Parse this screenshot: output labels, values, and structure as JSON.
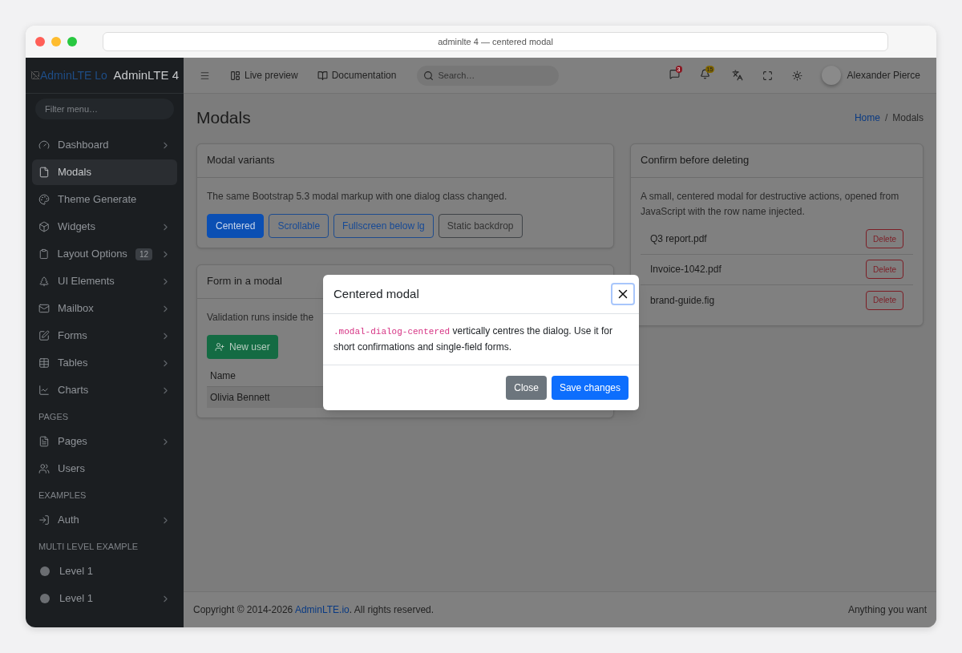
{
  "window": {
    "title": "adminlte 4 — centered modal"
  },
  "brand": {
    "logo_alt": "AdminLTE Lo",
    "name": "AdminLTE 4"
  },
  "sidebar": {
    "filter_placeholder": "Filter menu…",
    "groups": [
      {
        "items": [
          {
            "label": "Dashboard",
            "selected": false,
            "has_children": true
          },
          {
            "label": "Modals",
            "selected": true,
            "has_children": false
          },
          {
            "label": "Theme Generate",
            "selected": false,
            "has_children": false
          },
          {
            "label": "Widgets",
            "selected": false,
            "has_children": true
          },
          {
            "label": "Layout Options",
            "selected": false,
            "has_children": true,
            "badge": "12"
          },
          {
            "label": "UI Elements",
            "selected": false,
            "has_children": true
          },
          {
            "label": "Mailbox",
            "selected": false,
            "has_children": true
          },
          {
            "label": "Forms",
            "selected": false,
            "has_children": true
          },
          {
            "label": "Tables",
            "selected": false,
            "has_children": true
          },
          {
            "label": "Charts",
            "selected": false,
            "has_children": true
          }
        ]
      },
      {
        "header": "PAGES",
        "items": [
          {
            "label": "Pages",
            "selected": false,
            "has_children": true
          },
          {
            "label": "Users",
            "selected": false,
            "has_children": false
          }
        ]
      },
      {
        "header": "EXAMPLES",
        "items": [
          {
            "label": "Auth",
            "selected": false,
            "has_children": true
          }
        ]
      },
      {
        "header": "MULTI LEVEL EXAMPLE",
        "items": [
          {
            "label": "Level 1",
            "selected": false,
            "has_children": false
          },
          {
            "label": "Level 1",
            "selected": false,
            "has_children": true
          }
        ]
      }
    ]
  },
  "topbar": {
    "links": [
      "Live preview",
      "Documentation"
    ],
    "search_placeholder": "Search…",
    "messages_badge": "3",
    "notifications_badge": "15",
    "user": "Alexander Pierce"
  },
  "page": {
    "title": "Modals",
    "breadcrumb": [
      {
        "label": "Home",
        "link": true
      },
      {
        "label": "Modals",
        "link": false
      }
    ],
    "breadcrumb_separator": "/"
  },
  "variants_card": {
    "title": "Modal variants",
    "text": "The same Bootstrap 5.3 modal markup with one dialog class changed.",
    "buttons": [
      {
        "label": "Centered",
        "selected": true,
        "kind": "primary"
      },
      {
        "label": "Scrollable",
        "selected": false,
        "kind": "primary"
      },
      {
        "label": "Fullscreen below lg",
        "selected": false,
        "kind": "primary"
      },
      {
        "label": "Static backdrop",
        "selected": false,
        "kind": "secondary"
      }
    ]
  },
  "form_card": {
    "title": "Form in a modal",
    "text": "Validation runs inside the",
    "button": "New user",
    "table": {
      "columns": [
        "Name"
      ],
      "rows": [
        [
          "Olivia Bennett"
        ]
      ]
    }
  },
  "delete_card": {
    "title": "Confirm before deleting",
    "text": "A small, centered modal for destructive actions, opened from JavaScript with the row name injected.",
    "rows": [
      {
        "name": "Q3 report.pdf",
        "action": "Delete"
      },
      {
        "name": "Invoice-1042.pdf",
        "action": "Delete"
      },
      {
        "name": "brand-guide.fig",
        "action": "Delete"
      }
    ]
  },
  "modal": {
    "title": "Centered modal",
    "code": ".modal-dialog-centered",
    "text": " vertically centres the dialog. Use it for short confirmations and single-field forms.",
    "buttons": [
      "Close",
      "Save changes"
    ]
  },
  "footer": {
    "copyright": "Copyright © 2014-2026",
    "link": "AdminLTE.io",
    "rest": ". All rights reserved.",
    "right": "Anything you want"
  }
}
